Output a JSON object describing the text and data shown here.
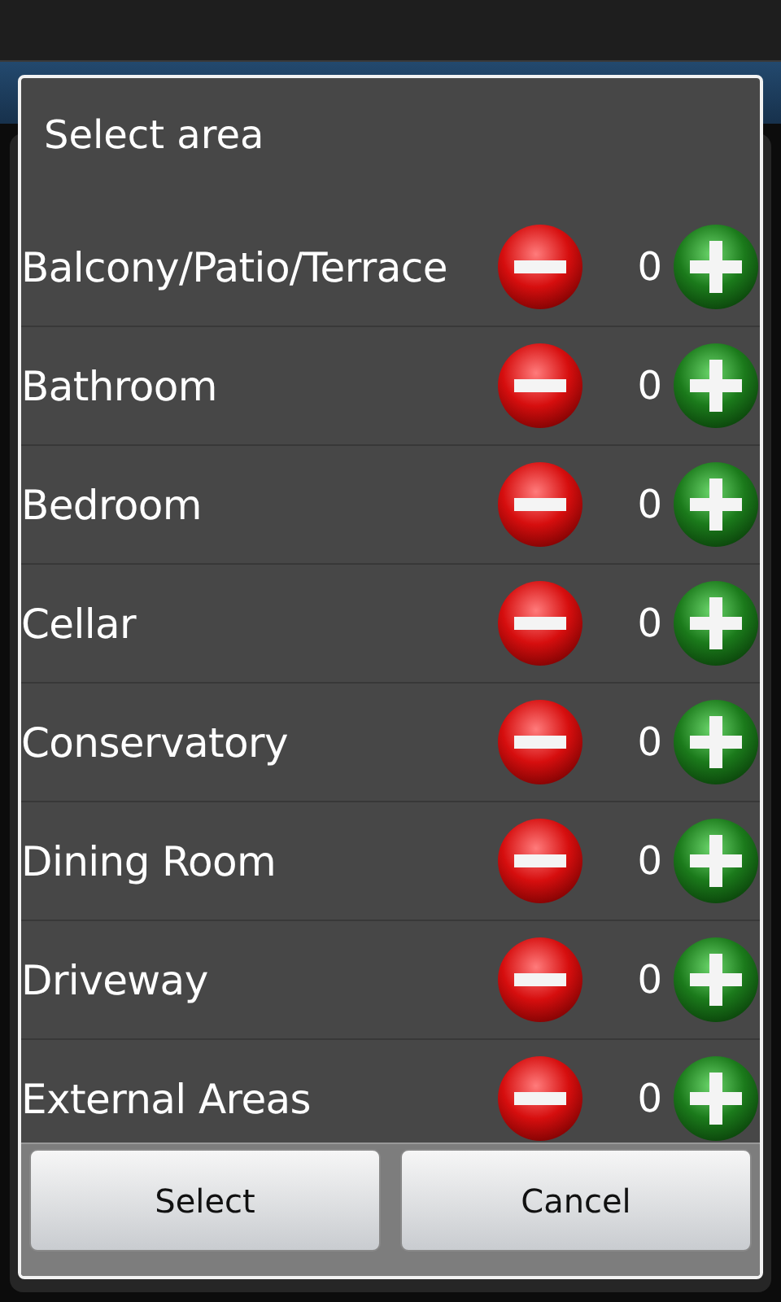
{
  "dialog": {
    "title": "Select area",
    "areas": [
      {
        "name": "Balcony/Patio/Terrace",
        "count": "0"
      },
      {
        "name": "Bathroom",
        "count": "0"
      },
      {
        "name": "Bedroom",
        "count": "0"
      },
      {
        "name": "Cellar",
        "count": "0"
      },
      {
        "name": "Conservatory",
        "count": "0"
      },
      {
        "name": "Dining Room",
        "count": "0"
      },
      {
        "name": "Driveway",
        "count": "0"
      },
      {
        "name": "External Areas",
        "count": "0"
      }
    ],
    "buttons": [
      "Select",
      "Cancel"
    ]
  }
}
